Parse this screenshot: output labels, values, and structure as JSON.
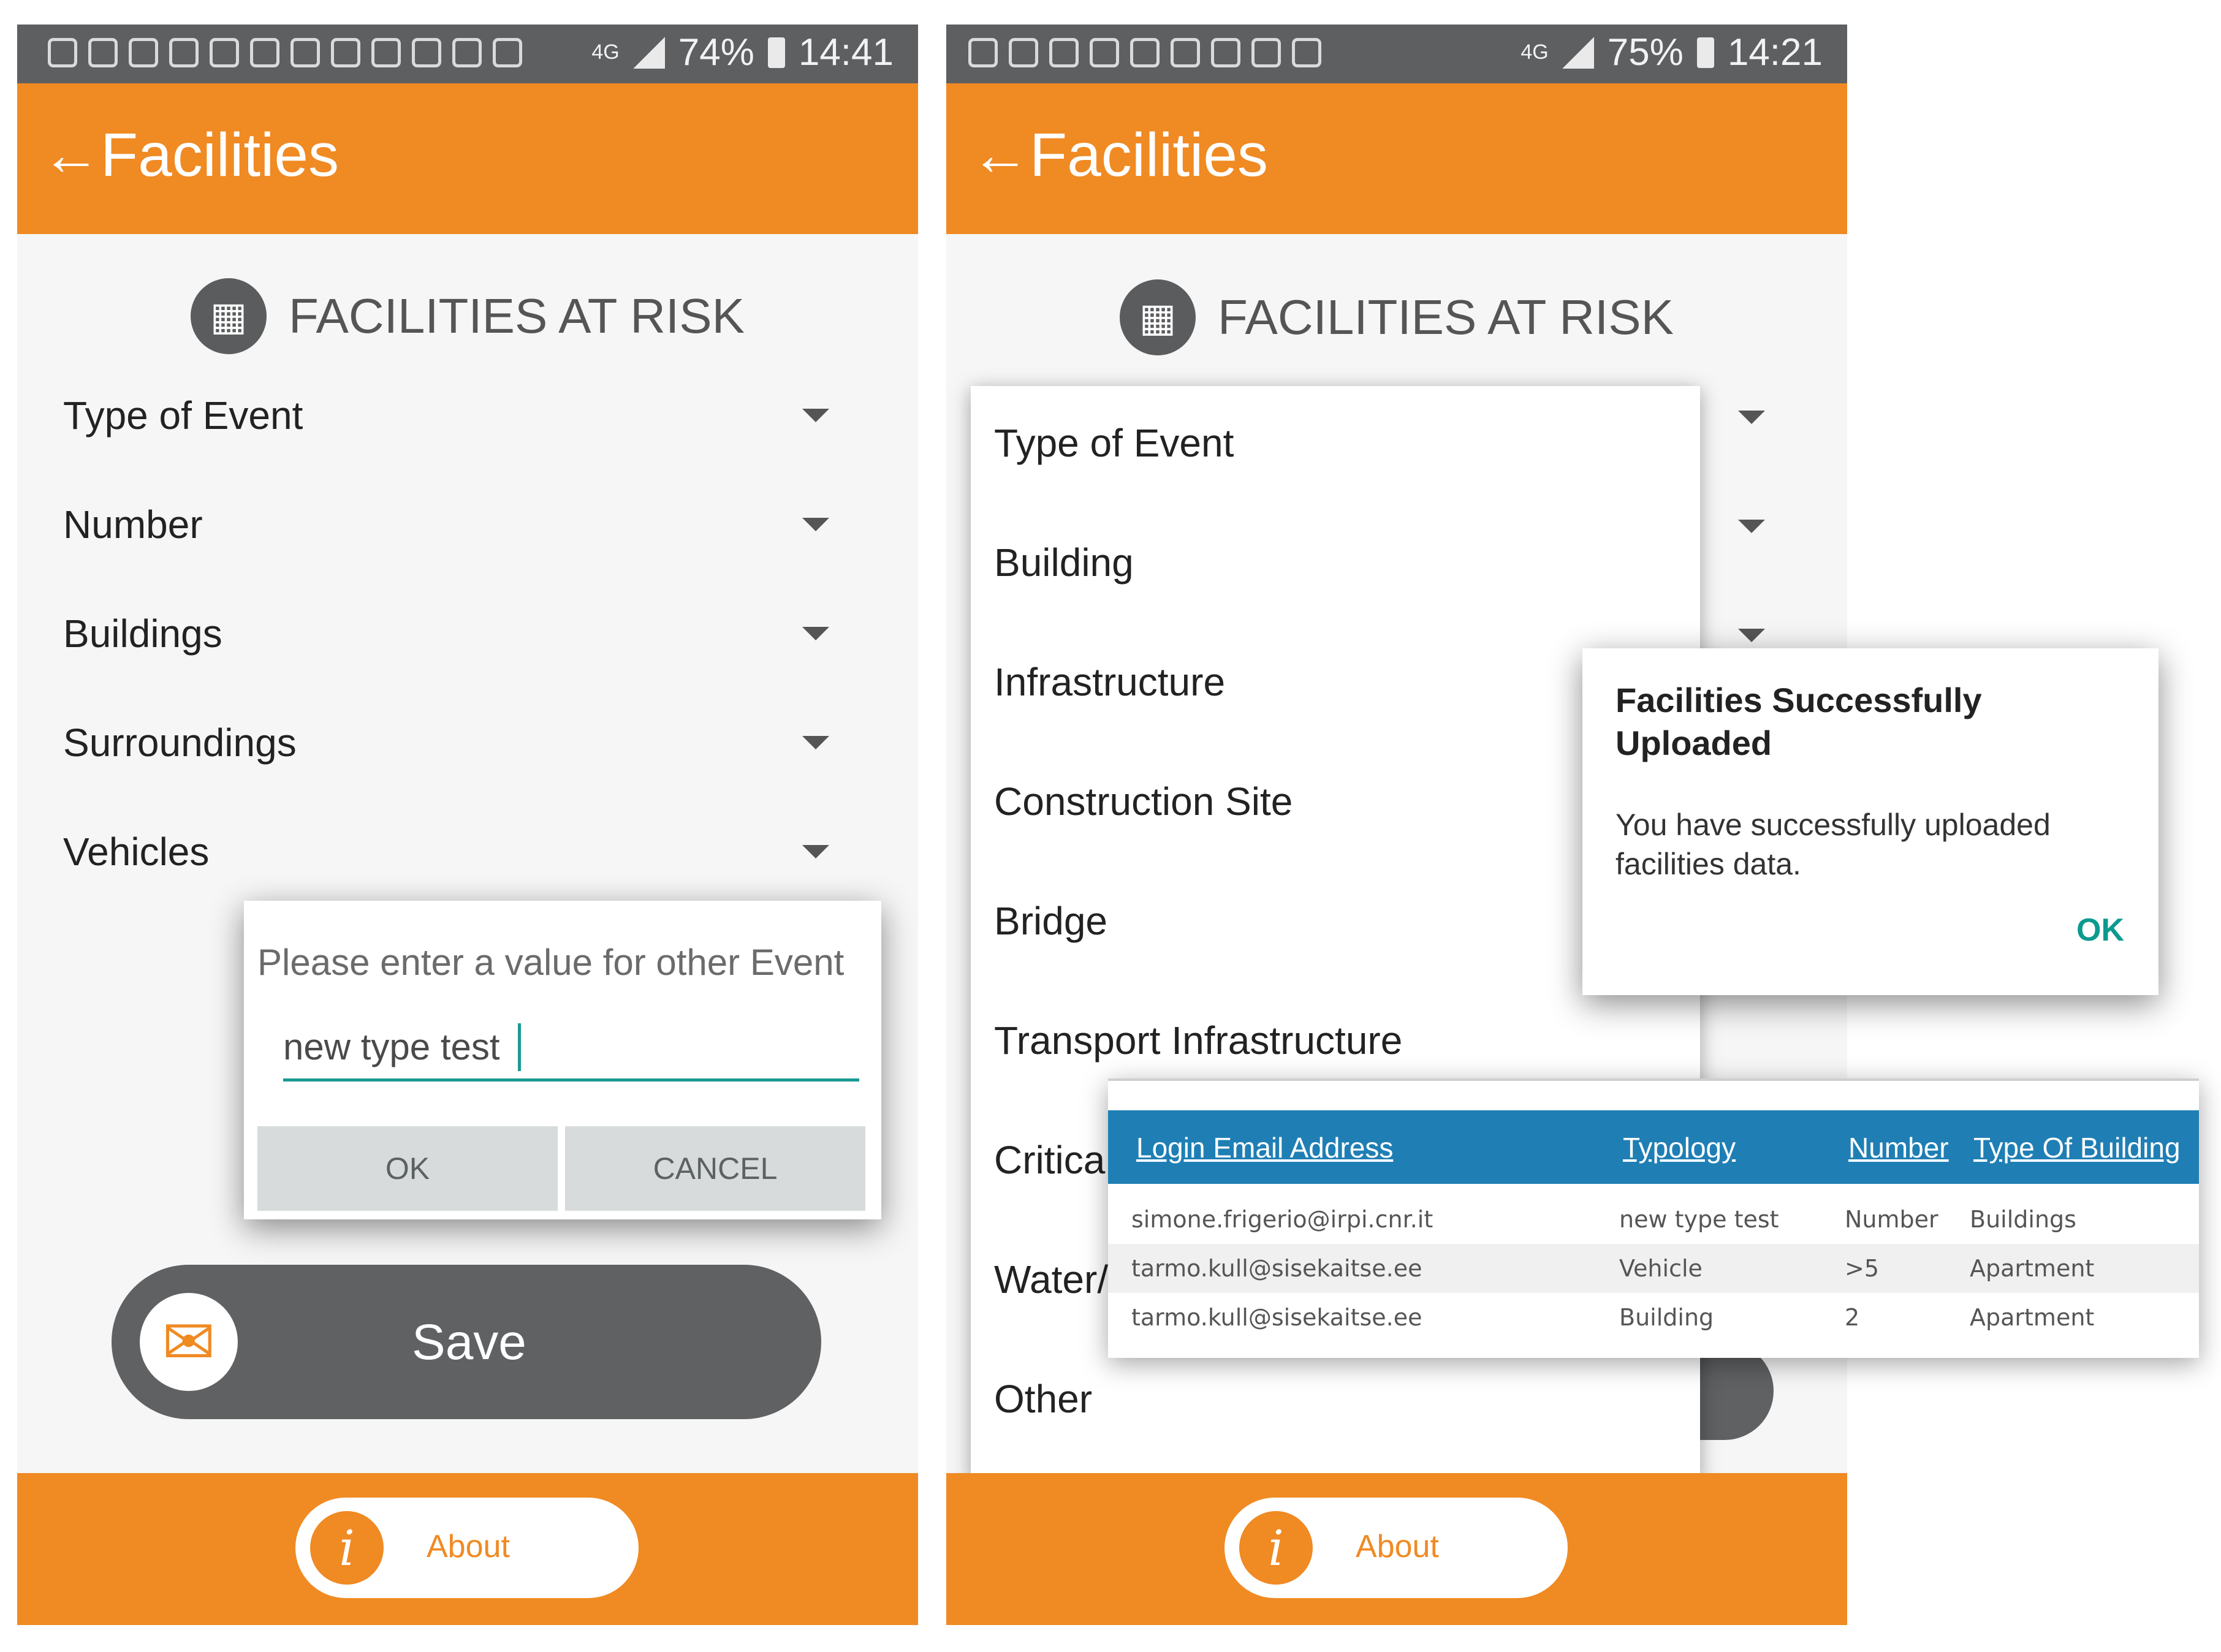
{
  "left": {
    "status": {
      "battery": "74%",
      "time": "14:41",
      "net": "4G"
    },
    "appbar": {
      "back": "←",
      "title": "Facilities"
    },
    "section": {
      "icon": "▦",
      "title": "FACILITIES AT RISK"
    },
    "rows": [
      "Type of Event",
      "Number",
      "Buildings",
      "Surroundings",
      "Vehicles"
    ],
    "dialog": {
      "prompt": "Please enter a value for other Event",
      "value": "new type test",
      "ok": "OK",
      "cancel": "CANCEL"
    },
    "save": {
      "icon": "✉",
      "label": "Save"
    },
    "about": {
      "icon": "i",
      "label": "About"
    }
  },
  "right": {
    "status": {
      "battery": "75%",
      "time": "14:21",
      "net": "4G"
    },
    "appbar": {
      "back": "←",
      "title": "Facilities"
    },
    "section": {
      "icon": "▦",
      "title": "FACILITIES AT RISK"
    },
    "menu": [
      "Type of Event",
      "Building",
      "Infrastructure",
      "Construction Site",
      "Bridge",
      "Transport Infrastructure",
      "Critica",
      "Water/",
      "Other"
    ],
    "alert": {
      "title": "Facilities Successfully Uploaded",
      "message": "You have successfully uploaded facilities data.",
      "ok": "OK"
    },
    "about": {
      "icon": "i",
      "label": "About"
    }
  },
  "table": {
    "headers": [
      "Login Email Address",
      "Typology",
      "Number",
      "Type Of Building"
    ],
    "rows": [
      [
        "simone.frigerio@irpi.cnr.it",
        "new type test",
        "Number",
        "Buildings"
      ],
      [
        "tarmo.kull@sisekaitse.ee",
        "Vehicle",
        ">5",
        "Apartment"
      ],
      [
        "tarmo.kull@sisekaitse.ee",
        "Building",
        "2",
        "Apartment"
      ]
    ]
  }
}
